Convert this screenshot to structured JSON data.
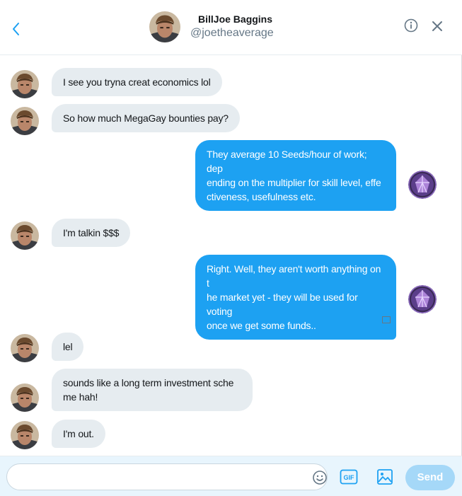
{
  "header": {
    "name": "BillJoe Baggins",
    "handle": "@joetheaverage"
  },
  "messages": [
    {
      "from": "them",
      "text": "I see you tryna creat economics lol"
    },
    {
      "from": "them",
      "text": "So how much MegaGay bounties pay?"
    },
    {
      "from": "me",
      "lines": [
        "They average 10 Seeds/hour of work; dep",
        "ending on the multiplier for skill level, effe",
        "ctiveness, usefulness etc."
      ]
    },
    {
      "from": "them",
      "text": "I'm talkin $$$"
    },
    {
      "from": "me",
      "lines": [
        "Right. Well, they aren't worth anything on t",
        "he market yet - they will be used for voting",
        "once we get some funds.."
      ]
    },
    {
      "from": "them",
      "text": "lel"
    },
    {
      "from": "them",
      "lines": [
        "sounds like a long term investment sche",
        "me hah!"
      ]
    },
    {
      "from": "them",
      "text": "I'm out."
    }
  ],
  "composer": {
    "placeholder": "",
    "send_label": "Send",
    "gif_label": "GIF"
  },
  "colors": {
    "accent": "#1da1f2",
    "incoming_bubble": "#e6ecf0",
    "send_disabled": "#a5d8f8"
  },
  "icons": {
    "back": "chevron-left-icon",
    "info": "info-icon",
    "close": "close-icon",
    "emoji": "emoji-icon",
    "gif": "gif-icon",
    "media": "image-icon"
  }
}
